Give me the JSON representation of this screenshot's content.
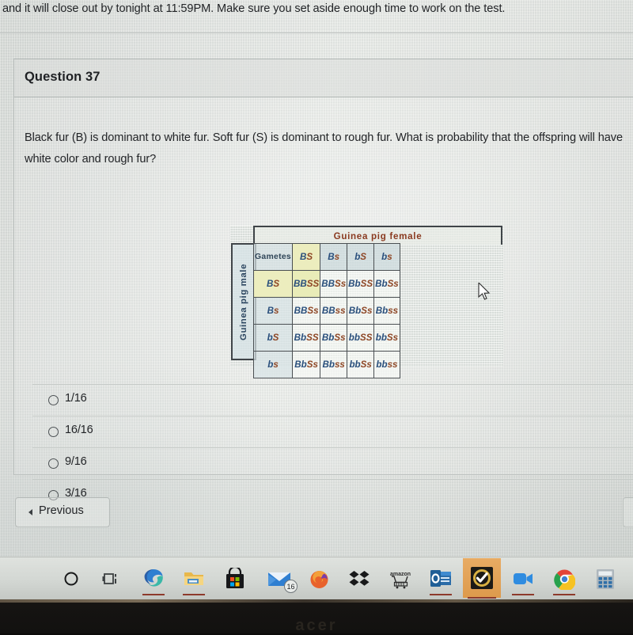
{
  "top_text": "and it will close out by tonight at 11:59PM. Make sure you set aside enough time to work on the test.",
  "question": {
    "title": "Question 37",
    "prompt": "Black fur (B) is dominant to white fur. Soft fur (S) is dominant to rough fur. What is probability that the offspring will have white color and rough fur?",
    "options": [
      {
        "label": "1/16",
        "selected": false
      },
      {
        "label": "16/16",
        "selected": false
      },
      {
        "label": "9/16",
        "selected": false
      },
      {
        "label": "3/16",
        "selected": false
      }
    ]
  },
  "punnett": {
    "female_label": "Guinea pig female",
    "male_label": "Guinea pig male",
    "gametes_label": "Gametes",
    "columns": [
      "BS",
      "Bs",
      "bS",
      "bs"
    ],
    "rows": [
      "BS",
      "Bs",
      "bS",
      "bs"
    ],
    "cells": [
      [
        "BBSS",
        "BBSs",
        "BbSS",
        "BbSs"
      ],
      [
        "BBSs",
        "BBss",
        "BbSs",
        "Bbss"
      ],
      [
        "BbSS",
        "BbSs",
        "bbSS",
        "bbSs"
      ],
      [
        "BbSs",
        "Bbss",
        "bbSs",
        "bbss"
      ]
    ],
    "colors": {
      "female_header": "#8a3a20",
      "male_header": "#2c4660",
      "allele_b": "#2a4f7c",
      "allele_s": "#8e4726",
      "highlight": "#ecedbe"
    }
  },
  "nav": {
    "previous_label": "Previous"
  },
  "taskbar": {
    "items": [
      {
        "name": "search-icon",
        "label": "Search"
      },
      {
        "name": "task-view-icon",
        "label": "Task View"
      },
      {
        "name": "edge-icon",
        "label": "Microsoft Edge"
      },
      {
        "name": "file-explorer-icon",
        "label": "File Explorer"
      },
      {
        "name": "microsoft-store-icon",
        "label": "Microsoft Store"
      },
      {
        "name": "mail-icon",
        "label": "Mail",
        "badge": "16"
      },
      {
        "name": "firefox-icon",
        "label": "Firefox"
      },
      {
        "name": "dropbox-icon",
        "label": "Dropbox"
      },
      {
        "name": "amazon-icon",
        "label": "amazon"
      },
      {
        "name": "outlook-icon",
        "label": "Outlook"
      },
      {
        "name": "checkmark-app-icon",
        "label": "Checkmark App"
      },
      {
        "name": "zoom-icon",
        "label": "Zoom"
      },
      {
        "name": "chrome-icon",
        "label": "Google Chrome"
      },
      {
        "name": "calculator-icon",
        "label": "Calculator"
      }
    ]
  },
  "device": {
    "logo": "acer"
  }
}
